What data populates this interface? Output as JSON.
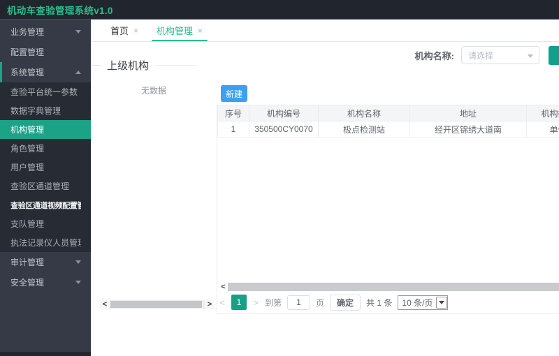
{
  "app": {
    "title": "机动车查验管理系统v1.0"
  },
  "colors": {
    "accent_green": "#2bbd8b",
    "active_menu_teal": "#1ba287",
    "primary_blue": "#3d9ff0",
    "search_button_teal": "#0fa08e",
    "pagination_active_teal": "#17a086",
    "topbar_bg": "#21252d",
    "sidebar_bg": "#353a46",
    "submenu_bg": "#272b33"
  },
  "sidebar": {
    "items": [
      {
        "label": "业务管理"
      },
      {
        "label": "配置管理"
      },
      {
        "label": "系统管理"
      },
      {
        "label": "查验平台统一参数"
      },
      {
        "label": "数据字典管理"
      },
      {
        "label": "机构管理"
      },
      {
        "label": "角色管理"
      },
      {
        "label": "用户管理"
      },
      {
        "label": "查验区通道管理"
      },
      {
        "label": "查验区通道视频配置管理"
      },
      {
        "label": "支队管理"
      },
      {
        "label": "执法记录仪人员管理"
      },
      {
        "label": "审计管理"
      },
      {
        "label": "安全管理"
      }
    ]
  },
  "tabs": {
    "items": [
      {
        "label": "首页"
      },
      {
        "label": "机构管理"
      }
    ],
    "close": "×"
  },
  "tree": {
    "title": "上级机构",
    "empty": "无数据"
  },
  "filter": {
    "label": "机构名称:",
    "placeholder": "请选择"
  },
  "toolbar": {
    "new_button": "新建"
  },
  "table": {
    "columns": [
      "序号",
      "机构编号",
      "机构名称",
      "地址",
      "机构类型"
    ],
    "rows": [
      [
        "1",
        "350500CY0070",
        "极点检测站",
        "经开区锦绣大道南",
        "单位"
      ]
    ]
  },
  "pagination": {
    "prev": "<",
    "page": "1",
    "next": ">",
    "goto_label": "到第",
    "goto_value": "1",
    "page_unit": "页",
    "confirm": "确定",
    "total": "共 1 条",
    "page_size": "10 条/页"
  },
  "scroll": {
    "left_arrow": "<",
    "right_arrow": ">"
  }
}
